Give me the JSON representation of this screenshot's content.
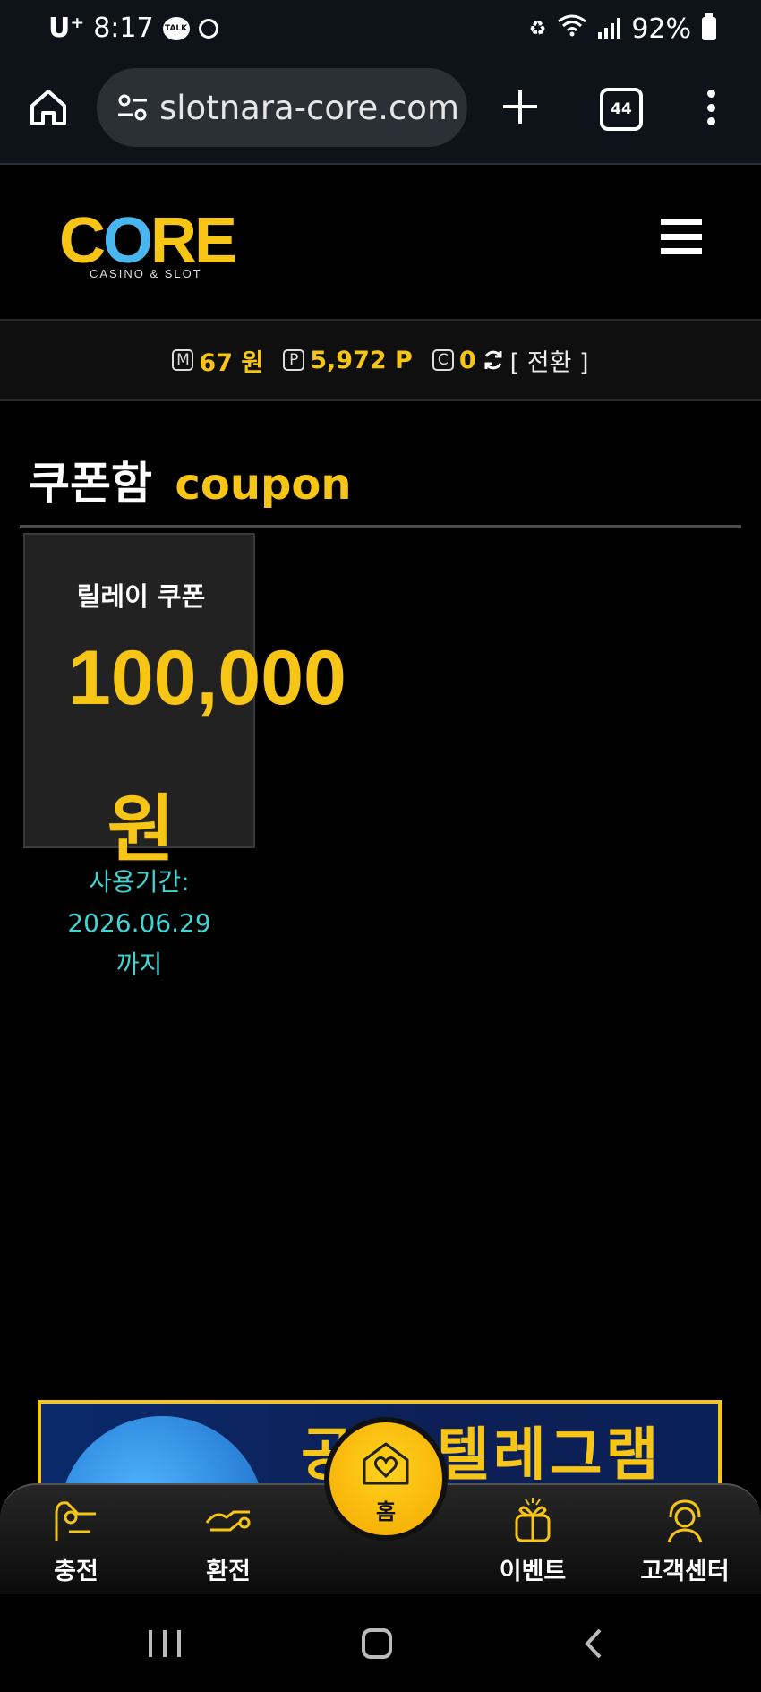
{
  "status_bar": {
    "carrier": "U⁺",
    "time": "8:17",
    "talk_badge": "TALK",
    "battery": "92%"
  },
  "browser": {
    "url": "slotnara-core.com",
    "tab_count": "44"
  },
  "site": {
    "logo_text": "CORE",
    "logo_subtitle": "CASINO & SLOT"
  },
  "balance": {
    "money_icon": "M",
    "money": "67 원",
    "point_icon": "P",
    "points": "5,972 P",
    "coupon_icon": "C",
    "coupons": "0",
    "switch_label": "[ 전환 ]"
  },
  "coupon_box": {
    "title_ko": "쿠폰함",
    "title_en": "coupon",
    "items": [
      {
        "name": "릴레이 쿠폰",
        "amount": "100,000",
        "unit": "원",
        "expiry_label": "사용기간:",
        "expiry_date": "2026.06.29",
        "expiry_suffix": "까지"
      }
    ]
  },
  "banner": {
    "text": "공식 텔레그램"
  },
  "bottom_nav": {
    "items": [
      {
        "label": "충전",
        "icon": "deposit-icon"
      },
      {
        "label": "환전",
        "icon": "exchange-icon"
      },
      {
        "label": "홈",
        "icon": "home-heart-icon"
      },
      {
        "label": "이벤트",
        "icon": "gift-icon"
      },
      {
        "label": "고객센터",
        "icon": "support-icon"
      }
    ]
  },
  "colors": {
    "accent": "#f7c515",
    "expiry": "#3fd5d5",
    "background": "#000000"
  }
}
